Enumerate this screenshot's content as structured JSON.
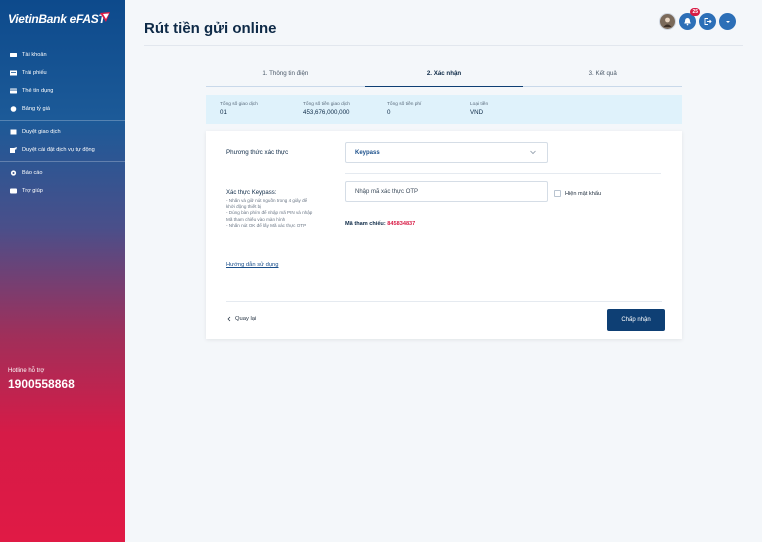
{
  "sidebar": {
    "logo": "VietinBank eFAST",
    "items": [
      {
        "label": "Tài khoản",
        "icon": "wallet-icon"
      },
      {
        "label": "Trái phiếu",
        "icon": "bond-icon"
      },
      {
        "label": "Thẻ tín dụng",
        "icon": "card-icon"
      },
      {
        "label": "Bảng tỷ giá",
        "icon": "exchange-icon"
      },
      {
        "label": "Duyệt giao dịch",
        "icon": "approve-icon"
      },
      {
        "label": "Duyệt cài đặt dịch vụ tự động",
        "icon": "auto-approve-icon"
      },
      {
        "label": "Báo cáo",
        "icon": "report-icon"
      },
      {
        "label": "Trợ giúp",
        "icon": "help-icon"
      }
    ],
    "hotline_label": "Hotline hỗ trợ",
    "hotline_number": "1900558868"
  },
  "header": {
    "title": "Rút tiền gửi online",
    "notification_count": "25"
  },
  "stepper": {
    "steps": [
      "1. Thông tin điện",
      "2. Xác nhận",
      "3. Kết quả"
    ],
    "active_index": 1
  },
  "summary": {
    "cols": [
      {
        "label": "Tổng số giao dịch",
        "value": "01"
      },
      {
        "label": "Tổng số tiền giao dịch",
        "value": "453,676,000,000"
      },
      {
        "label": "Tổng số tiền phí",
        "value": "0"
      },
      {
        "label": "Loại tiền",
        "value": "VND"
      }
    ]
  },
  "form": {
    "auth_method_label": "Phương thức xác thực",
    "auth_method_value": "Keypass",
    "keypass_title": "Xác thực Keypass:",
    "instructions": [
      "- Nhấn và giữ nút nguồn trong 4 giây để khởi động thiết bị",
      "- Dùng bàn phím để nhập mã PIN và nhập Mã tham chiếu vào màn hình",
      "- Nhấn nút OK để lấy Mã xác thực OTP"
    ],
    "otp_placeholder": "Nhập mã xác thực OTP",
    "show_password_label": "Hiện mật khẩu",
    "reference_label": "Mã tham chiếu:",
    "reference_code": "845834837",
    "guide_link": "Hướng dẫn sử dụng",
    "back_label": "Quay lại",
    "accept_label": "Chấp nhận"
  }
}
